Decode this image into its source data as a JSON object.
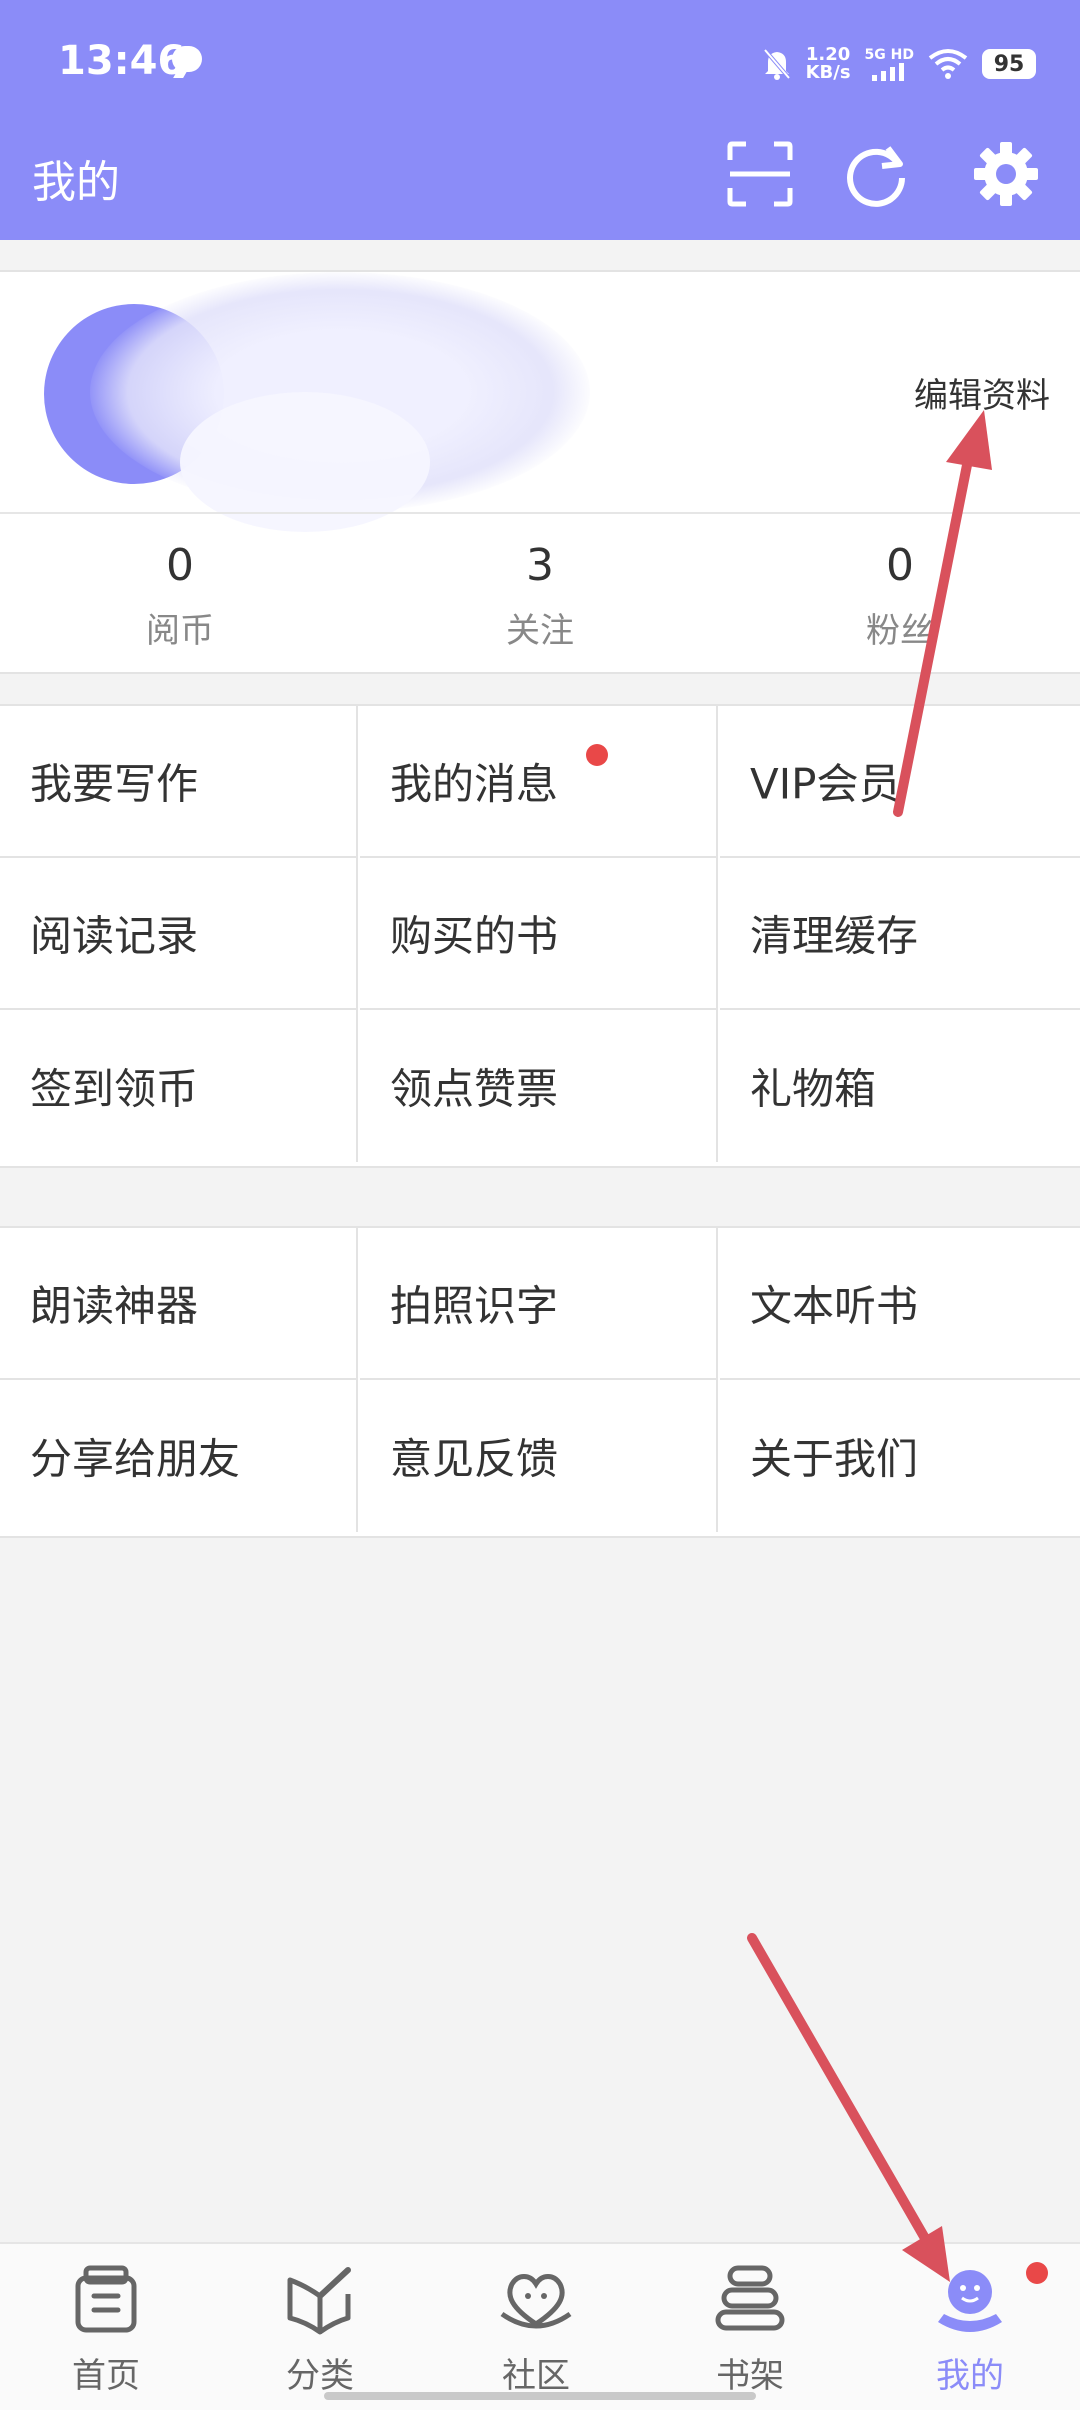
{
  "status_bar": {
    "time": "13:46",
    "net_speed_value": "1.20",
    "net_speed_unit": "KB/s",
    "network": "5G HD",
    "battery": "95"
  },
  "header": {
    "title": "我的"
  },
  "profile": {
    "edit_label": "编辑资料",
    "stats": [
      {
        "value": "0",
        "label": "阅币"
      },
      {
        "value": "3",
        "label": "关注"
      },
      {
        "value": "0",
        "label": "粉丝"
      }
    ]
  },
  "menu_group_1": [
    {
      "label": "我要写作"
    },
    {
      "label": "我的消息"
    },
    {
      "label": "VIP会员"
    },
    {
      "label": "阅读记录"
    },
    {
      "label": "购买的书"
    },
    {
      "label": "清理缓存"
    },
    {
      "label": "签到领币"
    },
    {
      "label": "领点赞票"
    },
    {
      "label": "礼物箱"
    }
  ],
  "menu_group_2": [
    {
      "label": "朗读神器"
    },
    {
      "label": "拍照识字"
    },
    {
      "label": "文本听书"
    },
    {
      "label": "分享给朋友"
    },
    {
      "label": "意见反馈"
    },
    {
      "label": "关于我们"
    }
  ],
  "bottom_nav": [
    {
      "label": "首页",
      "icon": "book-stack-icon"
    },
    {
      "label": "分类",
      "icon": "pen-book-icon"
    },
    {
      "label": "社区",
      "icon": "heart-icon"
    },
    {
      "label": "书架",
      "icon": "shelf-icon"
    },
    {
      "label": "我的",
      "icon": "profile-mascot-icon"
    }
  ],
  "colors": {
    "accent": "#8b8cf8",
    "badge": "#e94848",
    "annotation_arrow": "#d9515c"
  }
}
